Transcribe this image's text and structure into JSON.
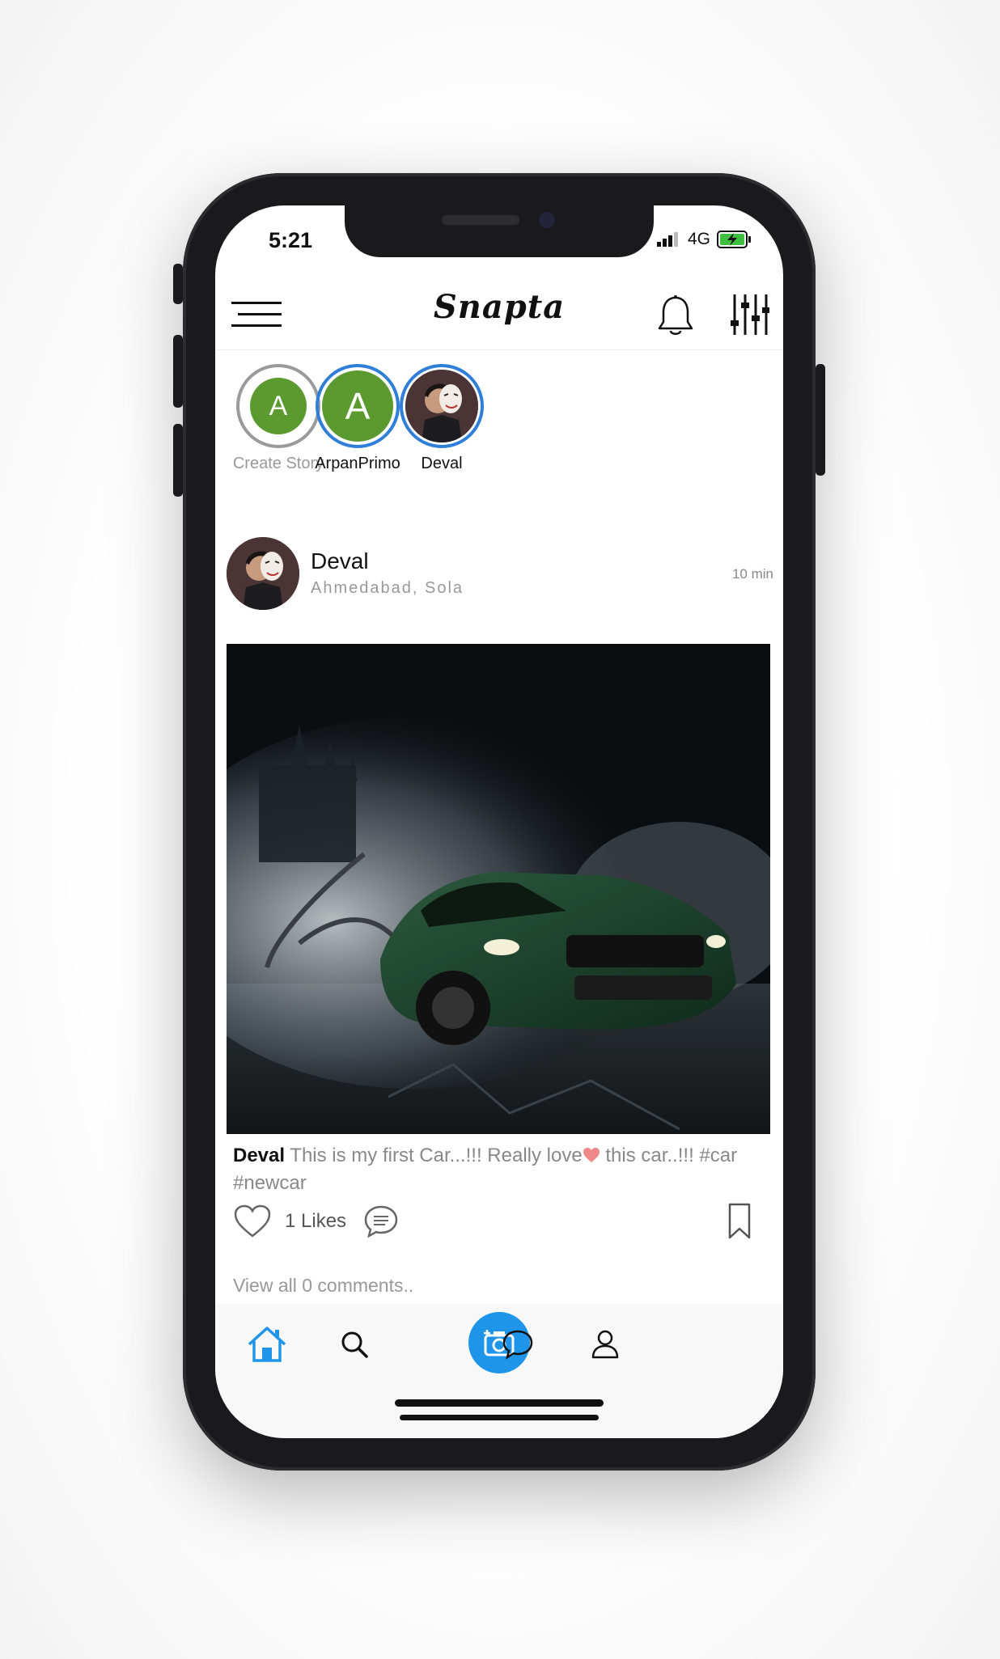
{
  "status_bar": {
    "time": "5:21",
    "network": "4G"
  },
  "header": {
    "app_title": "Snapta"
  },
  "stories": [
    {
      "initial": "A",
      "label": "Create Story",
      "ring_color": "#9a9a9a",
      "avatar_color": "#5a9a2f"
    },
    {
      "initial": "A",
      "label": "ArpanPrimo",
      "ring_color": "#2f7fd8",
      "avatar_color": "#5a9a2f"
    },
    {
      "initial": "",
      "label": "Deval",
      "ring_color": "#2f7fd8",
      "avatar_color": "#3a2e30"
    }
  ],
  "post": {
    "user": "Deval",
    "location": "Ahmedabad, Sola",
    "time": "10 min",
    "caption_user": "Deval",
    "caption_text_1": "This is my first Car...!!! Really love",
    "caption_text_2": "this car..!!! #car #newcar",
    "likes": "1 Likes",
    "view_comments": "View all 0 comments.."
  },
  "colors": {
    "accent": "#1f95e9",
    "story_green": "#5a9a2f",
    "heart": "#f08a8a"
  },
  "tabs": [
    "home-icon",
    "search-icon",
    "camera-icon",
    "chat-icon",
    "profile-icon"
  ]
}
